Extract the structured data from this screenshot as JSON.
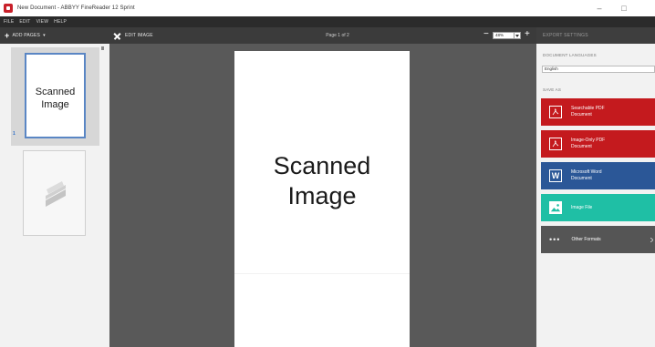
{
  "window": {
    "title": "New Document - ABBYY FineReader 12 Sprint",
    "minimize_glyph": "–",
    "maximize_glyph": "□"
  },
  "menu": {
    "items": [
      "FILE",
      "EDIT",
      "VIEW",
      "HELP"
    ]
  },
  "toolbar": {
    "add_pages_label": "ADD PAGES",
    "edit_image_label": "EDIT IMAGE",
    "page_indicator": "Page 1 of 2",
    "zoom_value": "48%",
    "zoom_minus": "−",
    "zoom_plus": "+"
  },
  "thumbnails": {
    "items": [
      {
        "text_line1": "Scanned",
        "text_line2": "Image",
        "number": "1",
        "selected": true
      },
      {
        "icon": "scanner-icon",
        "selected": false
      }
    ]
  },
  "viewer": {
    "page_text_line1": "Scanned",
    "page_text_line2": "Image"
  },
  "export": {
    "header": "EXPORT SETTINGS",
    "language_label": "DOCUMENT LANGUAGES",
    "language_value": "English",
    "save_as_label": "SAVE AS",
    "buttons": [
      {
        "line1": "Searchable PDF",
        "line2": "Document",
        "icon": "pdf-icon",
        "color": "#c41a1e"
      },
      {
        "line1": "Image-Only PDF",
        "line2": "Document",
        "icon": "pdf-icon",
        "color": "#c41a1e"
      },
      {
        "line1": "Microsoft Word",
        "line2": "Document",
        "icon": "word-icon",
        "color": "#2b5797"
      },
      {
        "line1": "Image File",
        "line2": "",
        "icon": "image-icon",
        "color": "#1fbfa5"
      },
      {
        "line1": "Other Formats",
        "line2": "",
        "icon": "more-icon",
        "color": "#555555"
      }
    ]
  }
}
